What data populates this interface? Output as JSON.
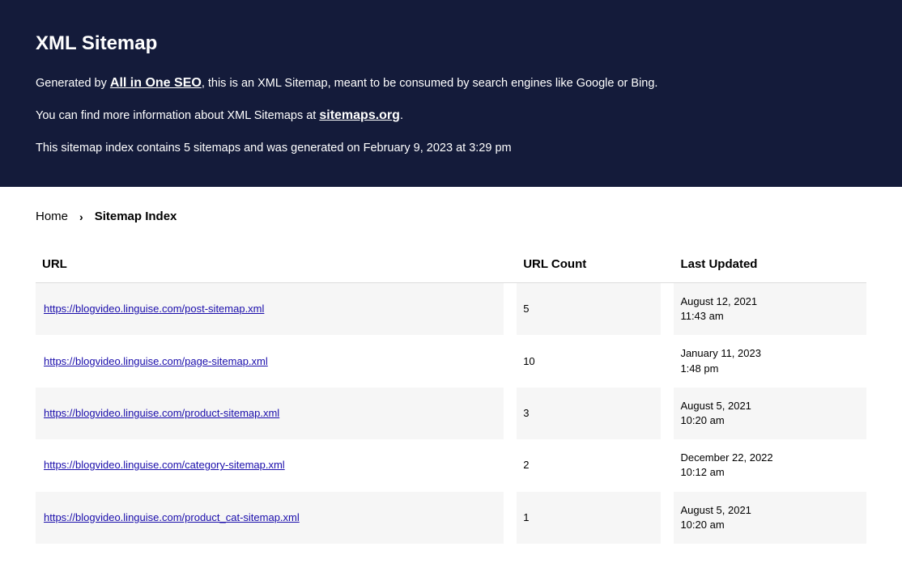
{
  "header": {
    "title": "XML Sitemap",
    "line1_prefix": "Generated by ",
    "line1_link": "All in One SEO",
    "line1_suffix": ", this is an XML Sitemap, meant to be consumed by search engines like Google or Bing.",
    "line2_prefix": "You can find more information about XML Sitemaps at ",
    "line2_link": "sitemaps.org",
    "line2_suffix": ".",
    "line3": "This sitemap index contains 5 sitemaps and was generated on February 9, 2023 at 3:29 pm"
  },
  "breadcrumb": {
    "home": "Home",
    "current": "Sitemap Index"
  },
  "table": {
    "headers": {
      "url": "URL",
      "count": "URL Count",
      "updated": "Last Updated"
    },
    "rows": [
      {
        "url": "https://blogvideo.linguise.com/post-sitemap.xml",
        "count": "5",
        "updated_date": "August 12, 2021",
        "updated_time": "11:43 am"
      },
      {
        "url": "https://blogvideo.linguise.com/page-sitemap.xml",
        "count": "10",
        "updated_date": "January 11, 2023",
        "updated_time": "1:48 pm"
      },
      {
        "url": "https://blogvideo.linguise.com/product-sitemap.xml",
        "count": "3",
        "updated_date": "August 5, 2021",
        "updated_time": "10:20 am"
      },
      {
        "url": "https://blogvideo.linguise.com/category-sitemap.xml",
        "count": "2",
        "updated_date": "December 22, 2022",
        "updated_time": "10:12 am"
      },
      {
        "url": "https://blogvideo.linguise.com/product_cat-sitemap.xml",
        "count": "1",
        "updated_date": "August 5, 2021",
        "updated_time": "10:20 am"
      }
    ]
  }
}
